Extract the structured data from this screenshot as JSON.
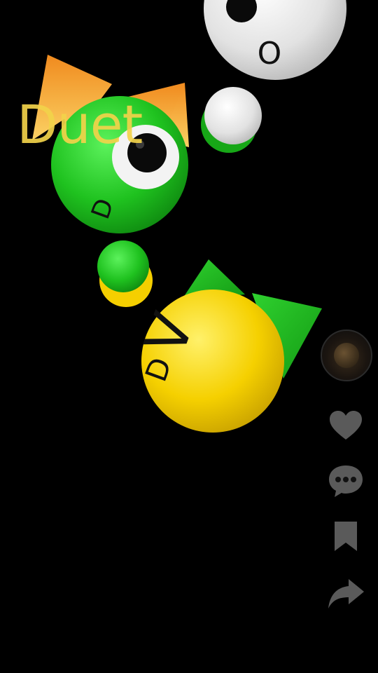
{
  "overlay": {
    "duet_label": "Duet"
  },
  "faces": {
    "green_mouth": "D",
    "yellow_mouth": "D",
    "yellow_eye": "V",
    "white_mouth": "O"
  },
  "icons": {
    "like": "heart-icon",
    "comment": "comment-icon",
    "save": "bookmark-icon",
    "share": "share-icon",
    "sound": "music-disc-icon"
  },
  "colors": {
    "background": "#000000",
    "green": "#1fc21f",
    "yellow": "#f5d000",
    "white": "#e6e6e6",
    "orange_ears": "#f5a623",
    "label": "#f2d34a",
    "rail_icons": "#5a5a5a"
  }
}
